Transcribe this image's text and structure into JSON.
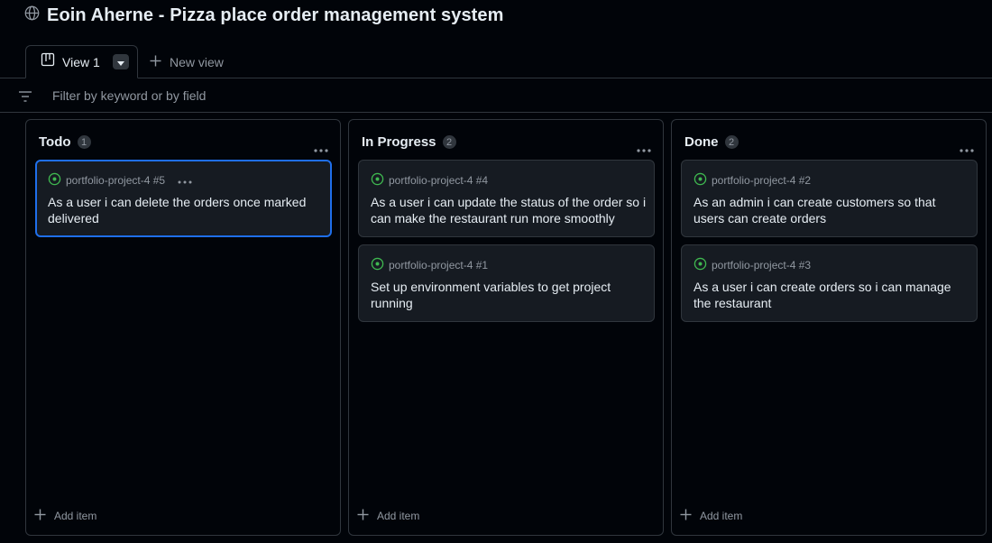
{
  "header": {
    "title": "Eoin Aherne - Pizza place order management system"
  },
  "tabs": {
    "view_label": "View 1",
    "new_view_label": "New view"
  },
  "filter": {
    "placeholder": "Filter by keyword or by field"
  },
  "colors": {
    "background": "#010409",
    "card": "#161b22",
    "border": "#30363d",
    "accent": "#1f6feb",
    "open_issue": "#3fb950"
  },
  "columns": [
    {
      "title": "Todo",
      "count": "1",
      "add_label": "Add item",
      "cards": [
        {
          "ref": "portfolio-project-4 #5",
          "title": "As a user i can delete the orders once marked delivered"
        }
      ]
    },
    {
      "title": "In Progress",
      "count": "2",
      "add_label": "Add item",
      "cards": [
        {
          "ref": "portfolio-project-4 #4",
          "title": "As a user i can update the status of the order so i can make the restaurant run more smoothly"
        },
        {
          "ref": "portfolio-project-4 #1",
          "title": "Set up environment variables to get project running"
        }
      ]
    },
    {
      "title": "Done",
      "count": "2",
      "add_label": "Add item",
      "cards": [
        {
          "ref": "portfolio-project-4 #2",
          "title": "As an admin i can create customers so that users can create orders"
        },
        {
          "ref": "portfolio-project-4 #3",
          "title": "As a user i can create orders so i can manage the restaurant"
        }
      ]
    }
  ]
}
